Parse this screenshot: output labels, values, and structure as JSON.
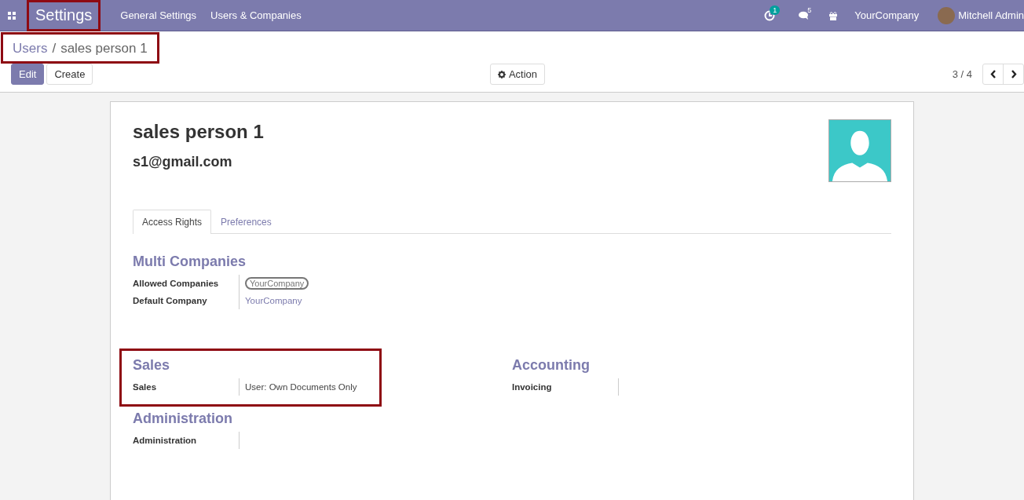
{
  "navbar": {
    "app_title": "Settings",
    "app_title_highlighted": true,
    "menus": [
      "General Settings",
      "Users & Companies"
    ],
    "activity_count": "1",
    "message_count": "5",
    "company": "YourCompany",
    "user": "Mitchell Admin"
  },
  "breadcrumb": {
    "items": [
      "Users",
      "sales person 1"
    ],
    "separator": "/",
    "highlighted": true
  },
  "buttons": [
    {
      "label": "Edit",
      "kind": "primary"
    },
    {
      "label": "Create",
      "kind": "secondary"
    }
  ],
  "action": "Action",
  "pager": "3 / 4",
  "form": {
    "name": "sales person 1",
    "email": "s1@gmail.com",
    "tabs": [
      {
        "label": "Access Rights",
        "selected": true
      },
      {
        "label": "Preferences",
        "selected": false
      }
    ],
    "group_rows": [
      {
        "groups": [
          {
            "title": "Multi Companies",
            "highlighted": false,
            "fields": [
              {
                "label": "Allowed Companies",
                "kind": "tag",
                "value": "YourCompany"
              },
              {
                "label": "Default Company",
                "kind": "link",
                "value": "YourCompany"
              }
            ]
          }
        ]
      },
      {
        "groups": [
          {
            "title": "Sales",
            "highlighted": true,
            "fields": [
              {
                "label": "Sales",
                "kind": "text",
                "value": "User: Own Documents Only"
              }
            ]
          },
          {
            "title": "Accounting",
            "highlighted": false,
            "fields": [
              {
                "label": "Invoicing",
                "kind": "text"
              }
            ]
          }
        ]
      },
      {
        "groups": [
          {
            "title": "Administration",
            "highlighted": false,
            "fields": [
              {
                "label": "Administration",
                "kind": "text"
              }
            ]
          }
        ]
      }
    ]
  }
}
